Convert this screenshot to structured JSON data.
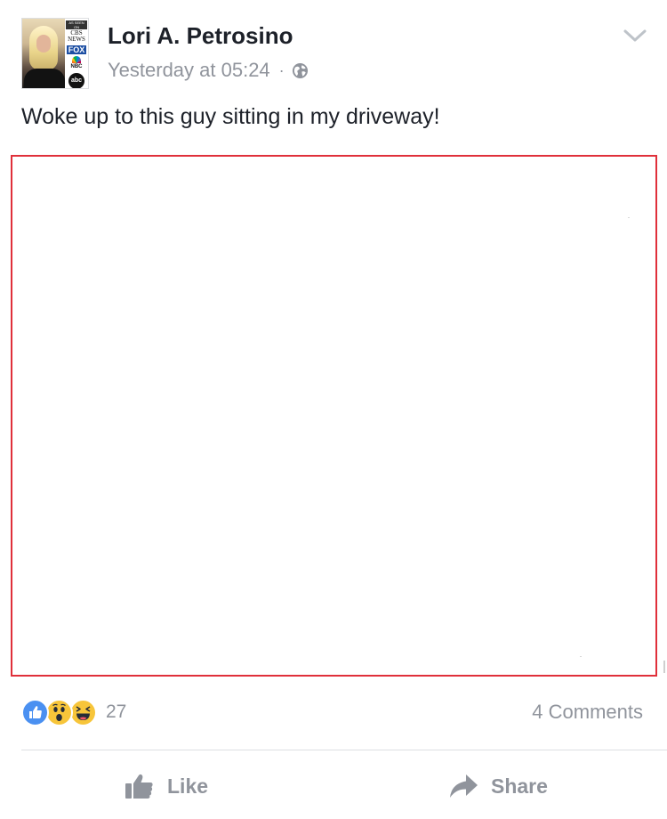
{
  "post": {
    "author": "Lori A. Petrosino",
    "timestamp": "Yesterday at 05:24",
    "separator": "·",
    "privacy_icon": "globe-icon",
    "menu_icon": "chevron-down-icon",
    "text": "Woke up to this guy sitting in my driveway!",
    "avatar_logos": {
      "as_seen_on": "AS SEEN ON",
      "cbs": "CBS NEWS",
      "fox": "FOX",
      "nbc": "NBC",
      "abc": "abc"
    }
  },
  "engagement": {
    "reaction_icons": [
      "like-reaction-icon",
      "wow-reaction-icon",
      "haha-reaction-icon"
    ],
    "reaction_count": "27",
    "comments_label": "4 Comments"
  },
  "actions": {
    "like_label": "Like",
    "share_label": "Share"
  },
  "colors": {
    "text_primary": "#1d2129",
    "text_secondary": "#90949c",
    "like_blue": "#4a90f1",
    "reaction_yellow": "#f7c53a",
    "media_border_red": "#e0303a",
    "divider": "#dddfe2"
  }
}
